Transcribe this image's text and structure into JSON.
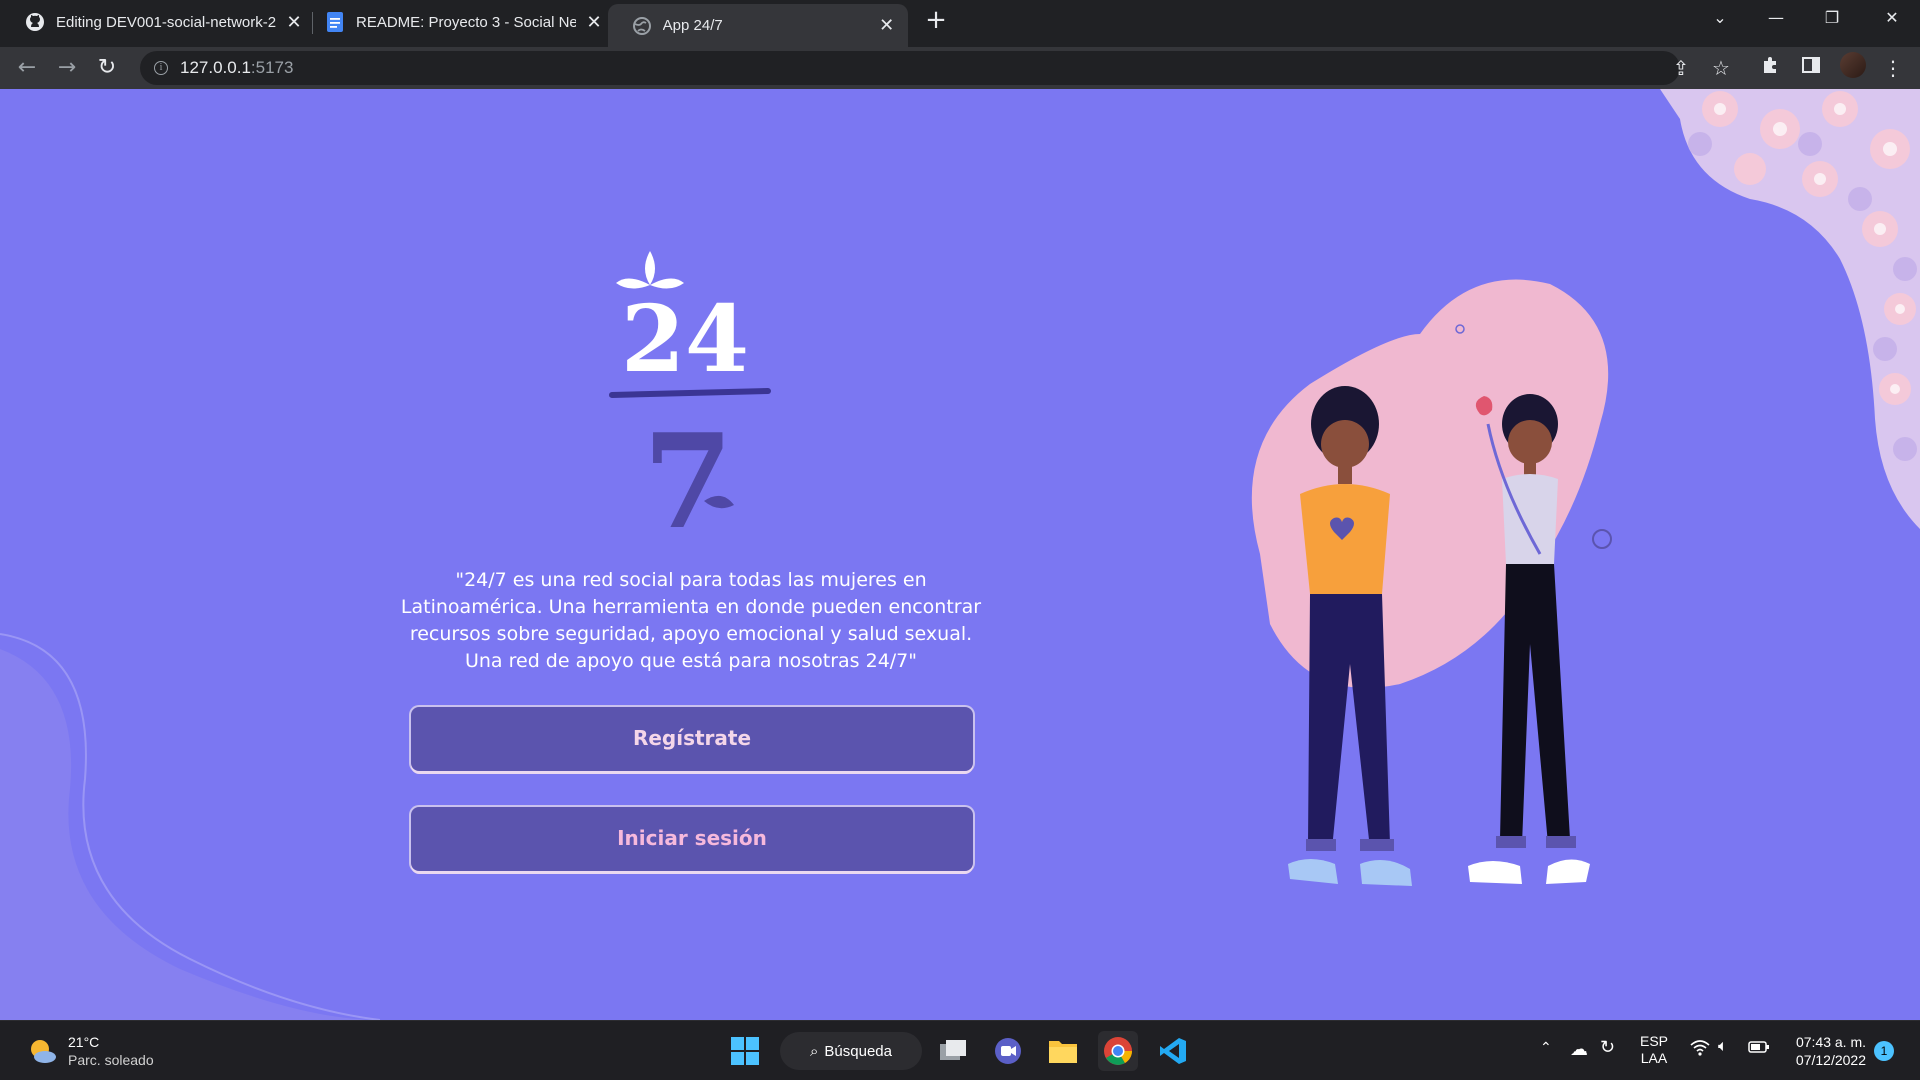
{
  "browser": {
    "tabs": [
      {
        "title": "Editing DEV001-social-network-2",
        "icon": "github-icon"
      },
      {
        "title": "README: Proyecto 3 - Social Net",
        "icon": "google-docs-icon"
      },
      {
        "title": "App 24/7",
        "icon": "globe-icon"
      }
    ],
    "active_tab": 2,
    "url_host": "127.0.0.1",
    "url_port": ":5173"
  },
  "page": {
    "logo_top": "24",
    "logo_bottom": "7",
    "description": "\"24/7 es una red social para todas las mujeres en Latinoamérica. Una herramienta en donde pueden encontrar recursos sobre seguridad, apoyo emocional y salud sexual. Una red de apoyo que está para nosotras 24/7\"",
    "register_label": "Regístrate",
    "login_label": "Iniciar sesión",
    "colors": {
      "background": "#7b77f2",
      "button": "#5b54ae",
      "register_text": "#f4d6e9",
      "login_text": "#f6b9dc",
      "blob": "#f0b8d0"
    }
  },
  "taskbar": {
    "weather_temp": "21°C",
    "weather_cond": "Parc. soleado",
    "search_label": "Búsqueda",
    "lang_top": "ESP",
    "lang_bottom": "LAA",
    "time": "07:43 a. m.",
    "date": "07/12/2022",
    "notifications": "1"
  }
}
